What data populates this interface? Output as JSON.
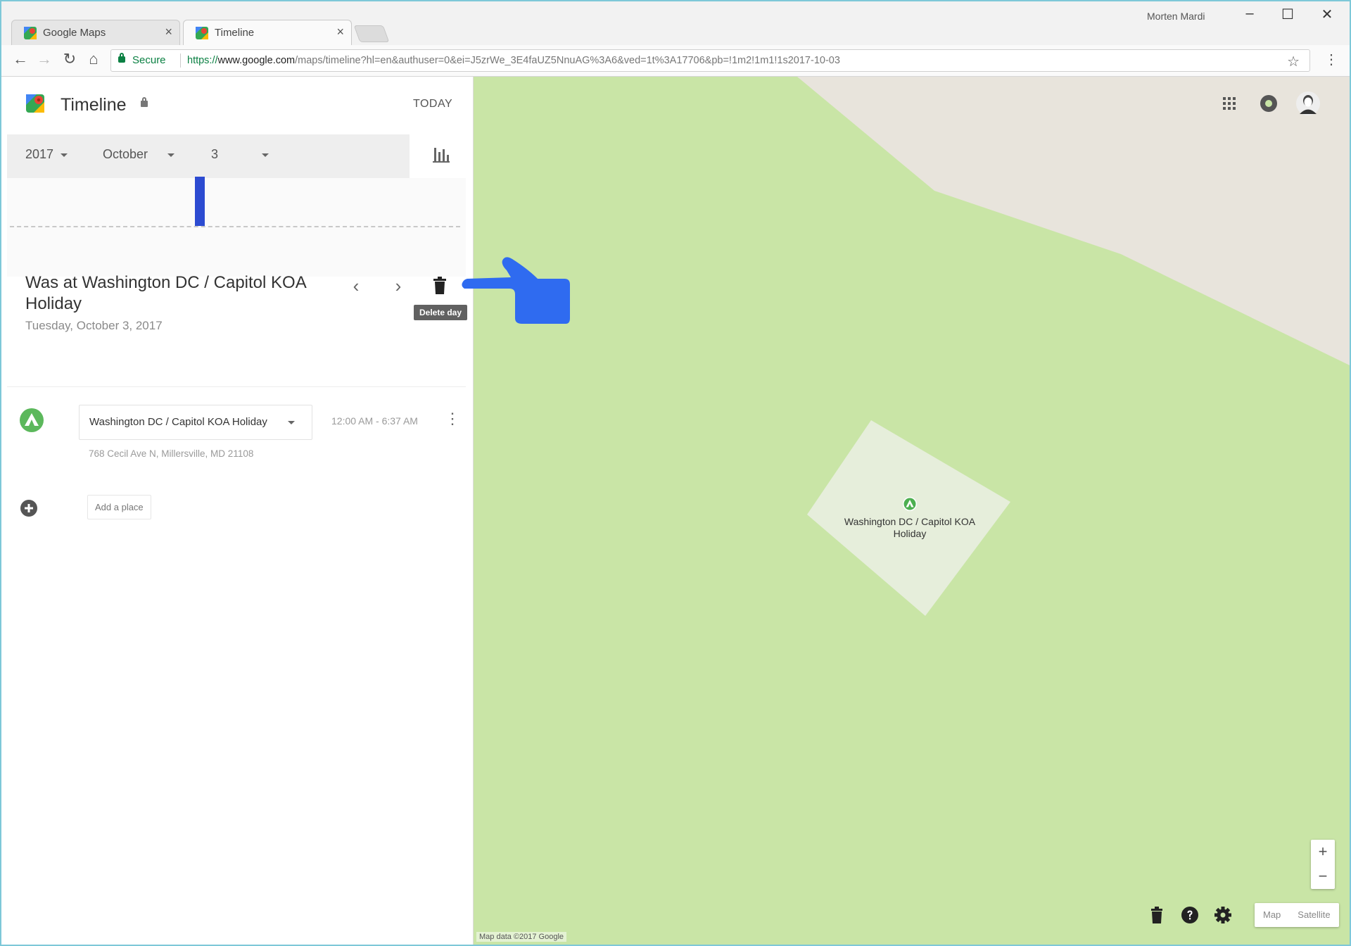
{
  "browser": {
    "tabs": [
      {
        "title": "Google Maps",
        "close": "×"
      },
      {
        "title": "Timeline",
        "close": "×"
      }
    ],
    "user_name": "Morten Mardi",
    "window_controls": {
      "minimize": "–",
      "maximize": "☐",
      "close": "✕"
    },
    "nav": {
      "back": "←",
      "forward": "→",
      "reload": "↻",
      "home": "⌂"
    },
    "secure_label": "Secure",
    "url_scheme": "https://",
    "url_host": "www.google.com",
    "url_path": "/maps/timeline?hl=en&authuser=0&ei=J5zrWe_3E4faUZ5NnuAG%3A6&ved=1t%3A17706&pb=!1m2!1m1!1s2017-10-03",
    "star": "☆",
    "menu": "⋮"
  },
  "sidebar": {
    "title": "Timeline",
    "today_label": "TODAY",
    "date_selectors": {
      "year": "2017",
      "month": "October",
      "day": "3"
    },
    "histogram": {
      "bars": [
        {
          "position": 0.41,
          "value": 1.0
        }
      ]
    },
    "day_title": "Was at Washington DC / Capitol KOA Holiday",
    "day_date": "Tuesday, October 3, 2017",
    "prev_label": "‹",
    "next_label": "›",
    "delete_tooltip": "Delete day",
    "visit": {
      "place_name": "Washington DC / Capitol KOA Holiday",
      "time_range": "12:00 AM - 6:37 AM",
      "address": "768 Cecil Ave N, Millersville, MD 21108",
      "more": "⋮"
    },
    "add_place_label": "Add a place"
  },
  "map": {
    "place_label": "Washington DC / Capitol KOA Holiday",
    "zoom_in": "+",
    "zoom_out": "−",
    "map_type_map": "Map",
    "map_type_satellite": "Satellite",
    "attribution": "Map data ©2017 Google"
  },
  "colors": {
    "park_green": "#c9e5a6",
    "land_beige": "#e8e4dc",
    "campground": "#e6eedb",
    "histogram_bar": "#2c4bd1",
    "hand_blue": "#2f6bf0",
    "secure_green": "#0b8043"
  },
  "icons": [
    "maps-logo-icon",
    "lock-icon",
    "chevron-down-icon",
    "bar-chart-icon",
    "trash-icon",
    "campground-icon",
    "add-circle-icon",
    "apps-grid-icon",
    "notification-icon",
    "avatar",
    "help-icon",
    "gear-icon",
    "pointing-hand-icon"
  ]
}
